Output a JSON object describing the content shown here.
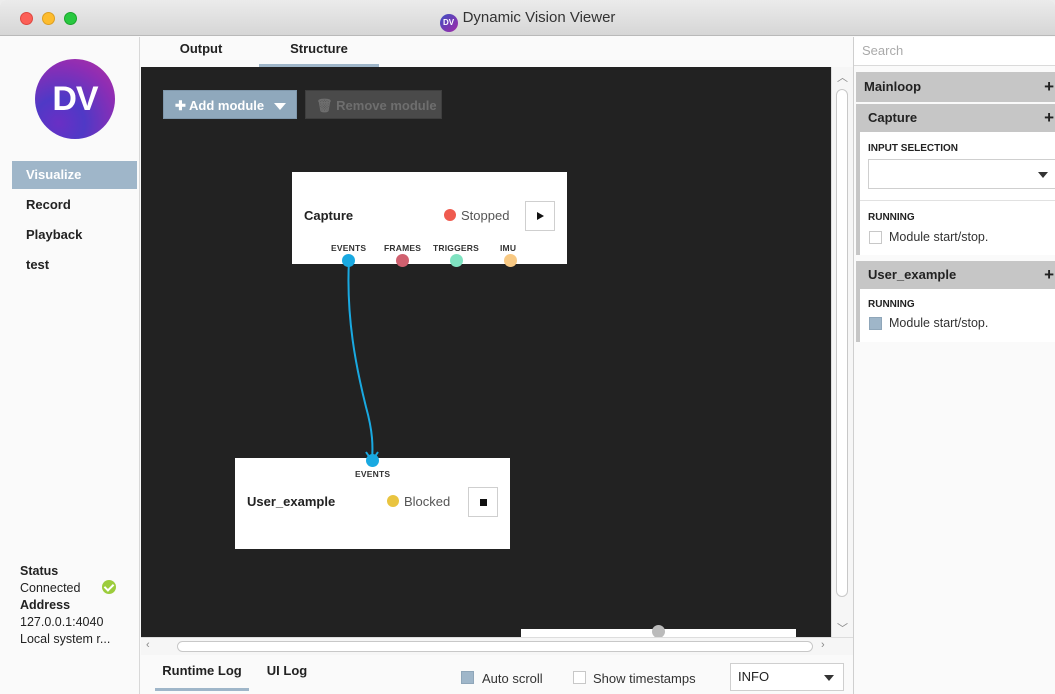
{
  "window": {
    "title": "Dynamic Vision Viewer",
    "icon_text": "DV"
  },
  "sidebar": {
    "logo_text": "DV",
    "items": [
      {
        "label": "Visualize",
        "active": true
      },
      {
        "label": "Record",
        "active": false
      },
      {
        "label": "Playback",
        "active": false
      },
      {
        "label": "test",
        "active": false
      }
    ],
    "status": {
      "status_label": "Status",
      "status_value": "Connected",
      "address_label": "Address",
      "address_value": "127.0.0.1:4040",
      "system_value": "Local system r..."
    }
  },
  "tabs": {
    "output": "Output",
    "structure": "Structure",
    "active": "Structure"
  },
  "canvas": {
    "add_module": "Add module",
    "remove_module": "Remove module",
    "modules": {
      "capture": {
        "name": "Capture",
        "status": "Stopped",
        "status_color": "#ef5b4f",
        "action_icon": "play-icon",
        "outputs": [
          {
            "label": "EVENTS",
            "color": "#19a9e1"
          },
          {
            "label": "FRAMES",
            "color": "#d0606f"
          },
          {
            "label": "TRIGGERS",
            "color": "#7fe3c1"
          },
          {
            "label": "IMU",
            "color": "#f8c983"
          }
        ]
      },
      "user_example": {
        "name": "User_example",
        "status": "Blocked",
        "status_color": "#e9c440",
        "action_icon": "stop-icon",
        "inputs": [
          {
            "label": "EVENTS",
            "color": "#19a9e1"
          }
        ]
      }
    },
    "connection_color": "#19a9e1"
  },
  "bottom": {
    "runtime_log": "Runtime Log",
    "ui_log": "UI Log",
    "auto_scroll": "Auto scroll",
    "auto_scroll_checked": true,
    "show_timestamps": "Show timestamps",
    "show_timestamps_checked": false,
    "log_level": "INFO"
  },
  "right_panel": {
    "search_placeholder": "Search",
    "plus": "+",
    "mainloop": "Mainloop",
    "capture": {
      "title": "Capture",
      "input_selection_label": "INPUT SELECTION",
      "input_selection_value": "",
      "running_label": "RUNNING",
      "running_text": "Module start/stop.",
      "running_checked": false
    },
    "user_example": {
      "title": "User_example",
      "running_label": "RUNNING",
      "running_text": "Module start/stop.",
      "running_checked": true
    }
  },
  "colors": {
    "accent": "#9fb6c9",
    "canvas_bg": "#222222"
  }
}
